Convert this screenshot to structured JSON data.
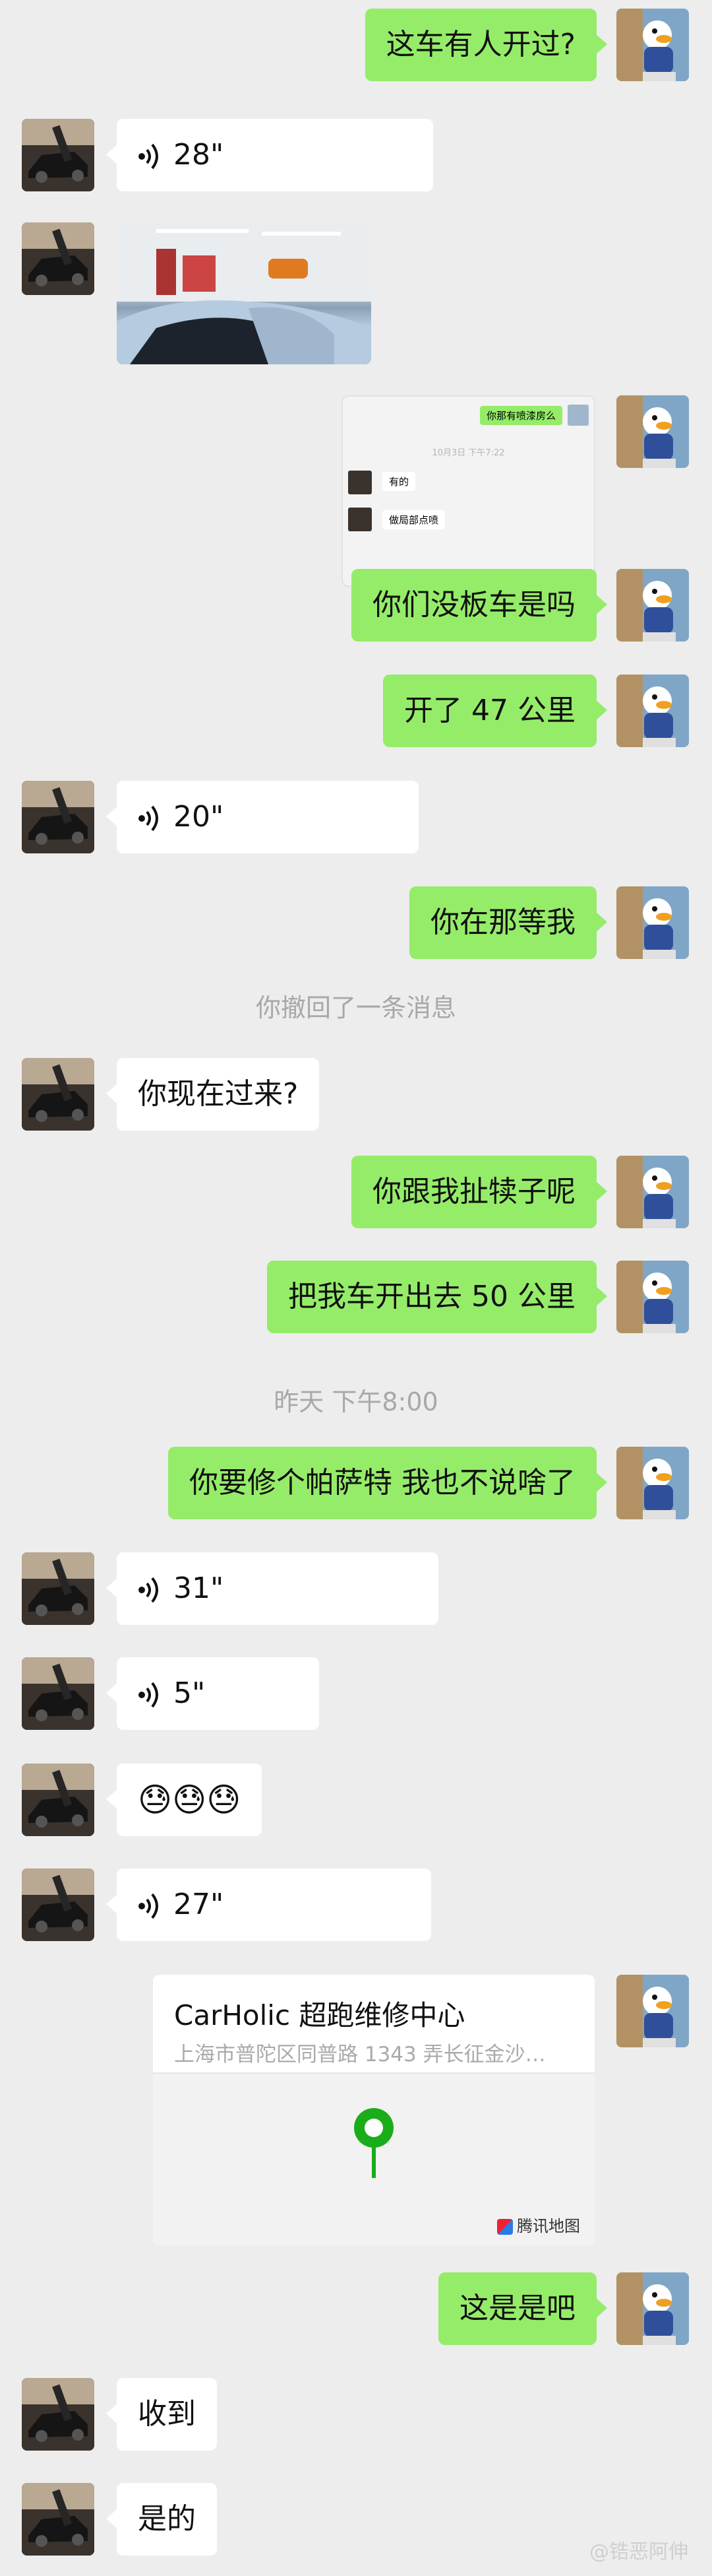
{
  "messages": {
    "m1": {
      "text": "这车有人开过?"
    },
    "m2": {
      "duration": "28\""
    },
    "m4": {
      "quoted_text": "你那有喷漆房么",
      "timestamp": "10月3日 下午7:22",
      "reply1": "有的",
      "reply2": "做局部点喷"
    },
    "m5": {
      "text": "你们没板车是吗"
    },
    "m6": {
      "text": "开了 47 公里"
    },
    "m7": {
      "duration": "20\""
    },
    "m8": {
      "text": "你在那等我"
    },
    "recall_notice": "你撤回了一条消息",
    "m9": {
      "text": "你现在过来?"
    },
    "m10": {
      "text": "你跟我扯犊子呢"
    },
    "m11": {
      "text": "把我车开出去 50 公里"
    },
    "time_divider": "昨天 下午8:00",
    "m12": {
      "text": "你要修个帕萨特 我也不说啥了"
    },
    "m13": {
      "duration": "31\""
    },
    "m14": {
      "duration": "5\""
    },
    "m15": {
      "text": "😓😓😓"
    },
    "m16": {
      "duration": "27\""
    },
    "location": {
      "title": "CarHolic 超跑维修中心",
      "address": "上海市普陀区同普路 1343 弄长征金沙…",
      "brand": "腾讯地图"
    },
    "m17": {
      "text": "这是是吧"
    },
    "m18": {
      "text": "收到"
    },
    "m19": {
      "text": "是的"
    }
  },
  "watermark": "@锆恶阿伸",
  "colors": {
    "background": "#ededed",
    "my_bubble": "#95ec69",
    "their_bubble": "#ffffff",
    "map_pin": "#1aad19",
    "meta_text": "#a8a8a8"
  },
  "icons": {
    "voice": "voice-wave-icon",
    "map_pin": "map-pin-icon",
    "map_brand": "tencent-map-logo-icon"
  }
}
